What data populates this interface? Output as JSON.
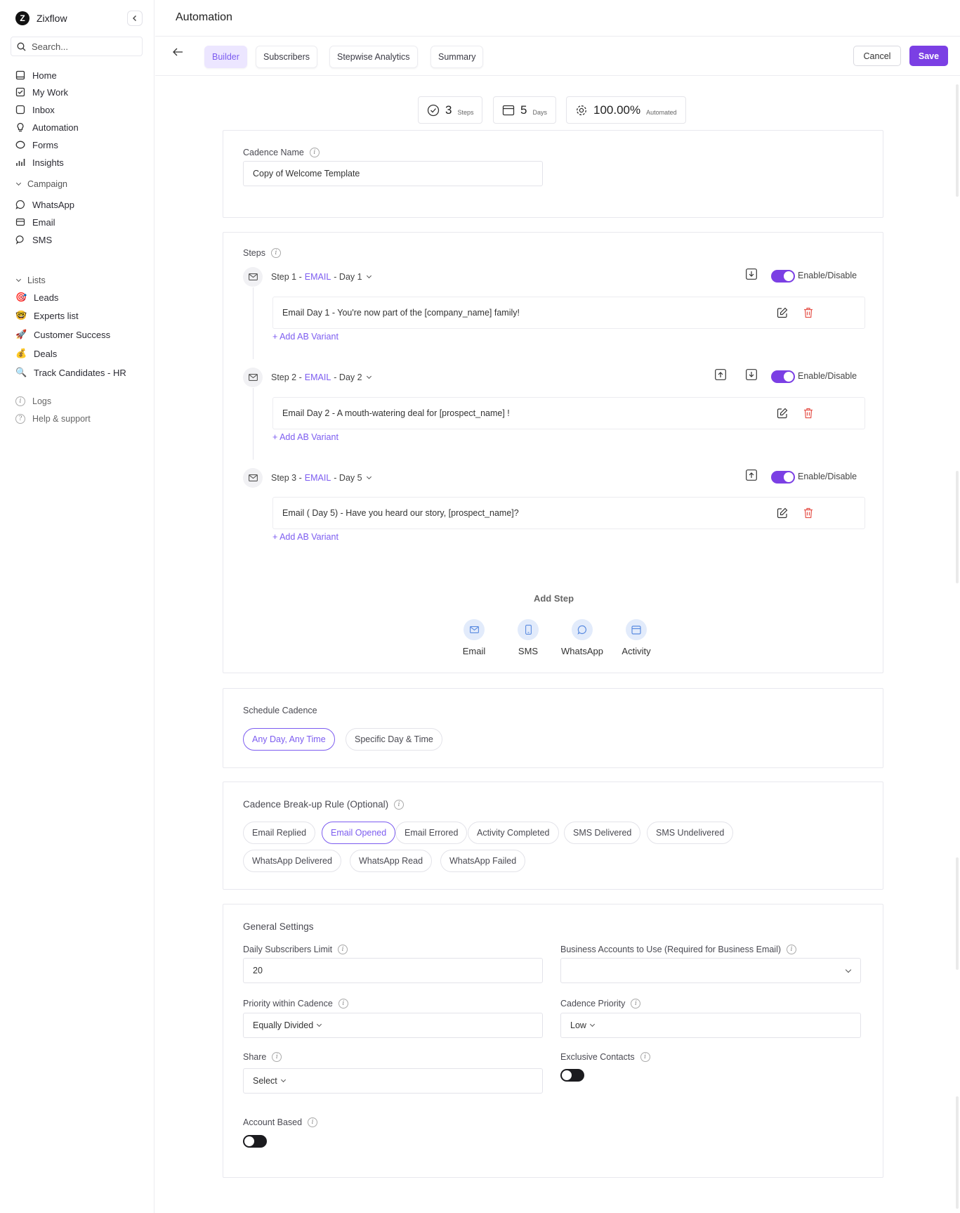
{
  "brand": {
    "name": "Zixflow",
    "logo_letter": "Z"
  },
  "search": {
    "placeholder": "Search..."
  },
  "nav": {
    "main": [
      {
        "label": "Home",
        "icon": "home-icon"
      },
      {
        "label": "My Work",
        "icon": "checklist-icon"
      },
      {
        "label": "Inbox",
        "icon": "inbox-icon"
      },
      {
        "label": "Automation",
        "icon": "bulb-icon"
      },
      {
        "label": "Forms",
        "icon": "forms-icon"
      },
      {
        "label": "Insights",
        "icon": "bar-chart-icon"
      }
    ],
    "campaign_title": "Campaign",
    "campaign": [
      {
        "label": "WhatsApp",
        "icon": "whatsapp-icon"
      },
      {
        "label": "Email",
        "icon": "email-icon"
      },
      {
        "label": "SMS",
        "icon": "sms-icon"
      }
    ],
    "lists_title": "Lists",
    "lists": [
      {
        "label": "Leads",
        "emoji": "🎯"
      },
      {
        "label": "Experts list",
        "emoji": "🤓"
      },
      {
        "label": "Customer Success",
        "emoji": "🚀"
      },
      {
        "label": "Deals",
        "emoji": "💰"
      },
      {
        "label": "Track Candidates - HR",
        "emoji": "🔍"
      }
    ],
    "bottom": [
      {
        "label": "Logs",
        "icon": "info-icon"
      },
      {
        "label": "Help & support",
        "icon": "help-icon"
      }
    ]
  },
  "header": {
    "title": "Automation"
  },
  "tabs": [
    "Builder",
    "Subscribers",
    "Stepwise Analytics",
    "Summary"
  ],
  "actions": {
    "cancel": "Cancel",
    "save": "Save"
  },
  "stats": [
    {
      "value": "3",
      "unit": "Steps",
      "icon": "check-circle-icon"
    },
    {
      "value": "5",
      "unit": "Days",
      "icon": "calendar-icon"
    },
    {
      "value": "100.00%",
      "unit": "Automated",
      "icon": "gear-icon"
    }
  ],
  "cadence": {
    "label": "Cadence Name",
    "value": "Copy of Welcome Template"
  },
  "steps": {
    "label": "Steps",
    "enable_label": "Enable/Disable",
    "ab_variant": "+ Add AB Variant",
    "items": [
      {
        "step": "Step 1 -",
        "channel": "EMAIL",
        "day": "- Day 1",
        "subject": "Email Day 1 - You're now part of the [company_name] family!",
        "enabled": true
      },
      {
        "step": "Step 2 -",
        "channel": "EMAIL",
        "day": "- Day 2",
        "subject": "Email Day 2 - A mouth-watering deal for [prospect_name] !",
        "enabled": true
      },
      {
        "step": "Step 3 -",
        "channel": "EMAIL",
        "day": "- Day 5",
        "subject": "Email ( Day 5) - Have you heard our story, [prospect_name]?",
        "enabled": true
      }
    ]
  },
  "add_step": {
    "title": "Add Step",
    "options": [
      "Email",
      "SMS",
      "WhatsApp",
      "Activity"
    ]
  },
  "schedule": {
    "label": "Schedule Cadence",
    "options": [
      "Any Day, Any Time",
      "Specific Day & Time"
    ],
    "selected": "Any Day, Any Time"
  },
  "breakup": {
    "label": "Cadence Break-up Rule (Optional)",
    "rules": [
      "Email Replied",
      "Email Opened",
      "Email Errored",
      "Activity Completed",
      "SMS Delivered",
      "SMS Undelivered",
      "WhatsApp Delivered",
      "WhatsApp Read",
      "WhatsApp Failed"
    ],
    "selected": "Email Opened"
  },
  "general": {
    "title": "General Settings",
    "daily_limit_label": "Daily Subscribers Limit",
    "daily_limit_value": "20",
    "business_accounts_label": "Business Accounts to Use (Required for Business Email)",
    "priority_within_label": "Priority within Cadence",
    "priority_within_value": "Equally Divided",
    "cadence_priority_label": "Cadence Priority",
    "cadence_priority_value": "Low",
    "share_label": "Share",
    "share_value": "Select",
    "exclusive_label": "Exclusive Contacts",
    "exclusive_on": false,
    "account_based_label": "Account Based",
    "account_based_on": false
  },
  "colors": {
    "accent": "#7b3fe4",
    "link": "#7c5cf0",
    "danger": "#e5534b"
  }
}
